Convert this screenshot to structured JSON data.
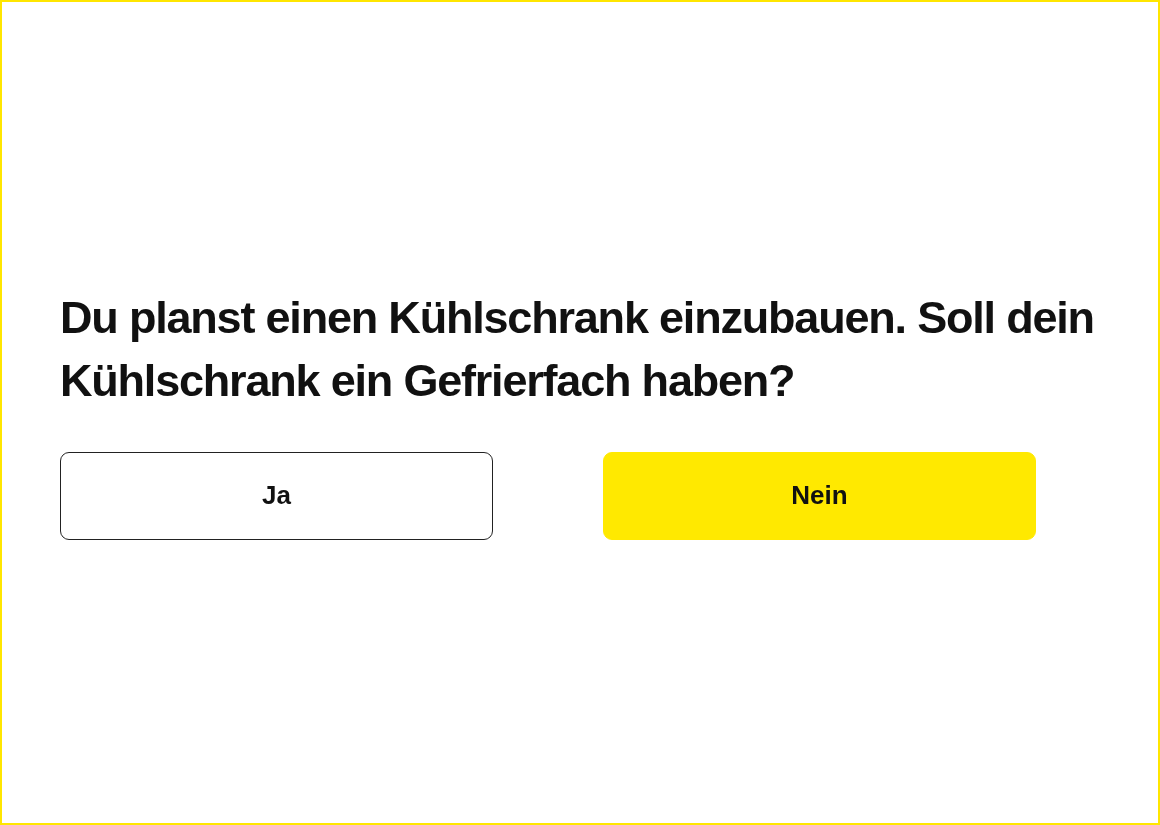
{
  "question": "Du planst einen Kühlschrank einzubauen. Soll dein Kühlschrank ein Gefrierfach haben?",
  "options": [
    {
      "label": "Ja",
      "selected": false
    },
    {
      "label": "Nein",
      "selected": true
    }
  ]
}
